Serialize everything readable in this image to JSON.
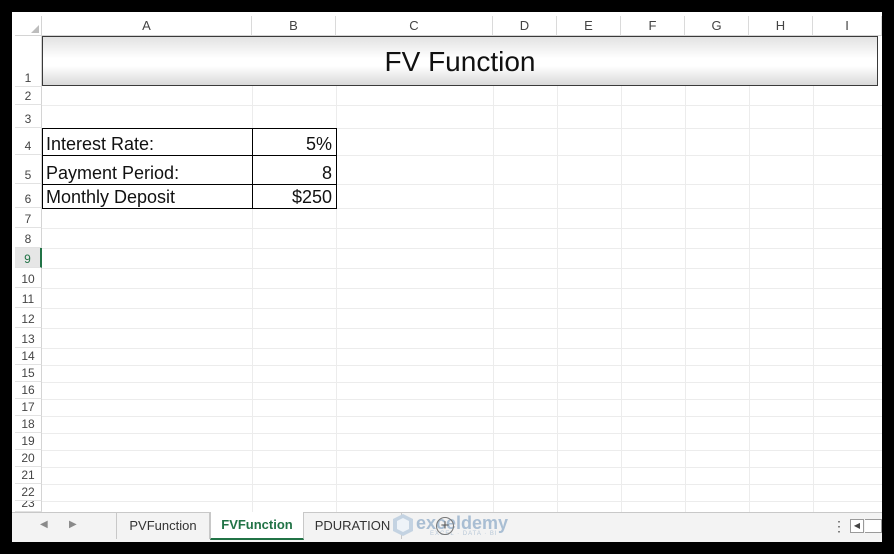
{
  "columns": [
    "A",
    "B",
    "C",
    "D",
    "E",
    "F",
    "G",
    "H",
    "I"
  ],
  "rows": [
    "1",
    "2",
    "3",
    "4",
    "5",
    "6",
    "7",
    "8",
    "9",
    "10",
    "11",
    "12",
    "13",
    "14",
    "15",
    "16",
    "17",
    "18",
    "19",
    "20",
    "21",
    "22",
    "23"
  ],
  "active_row": "9",
  "title": "FV Function",
  "table": [
    {
      "label": "Interest Rate:",
      "value": "5%"
    },
    {
      "label": "Payment Period:",
      "value": "8"
    },
    {
      "label": "Monthly Deposit",
      "value": "$250"
    }
  ],
  "sheet_tabs": [
    {
      "label": "PVFunction",
      "active": false
    },
    {
      "label": "FVFunction",
      "active": true
    },
    {
      "label": "PDURATION",
      "active": false
    }
  ],
  "add_sheet_symbol": "+",
  "watermark": {
    "name": "exceldemy",
    "tagline": "EXCEL · DATA · BI"
  },
  "icons": {
    "nav_prev": "triangle-left-icon",
    "nav_next": "triangle-right-icon",
    "more": "vertical-ellipsis-icon",
    "scroll_left": "triangle-left-icon"
  },
  "colors": {
    "accent": "#217346"
  }
}
